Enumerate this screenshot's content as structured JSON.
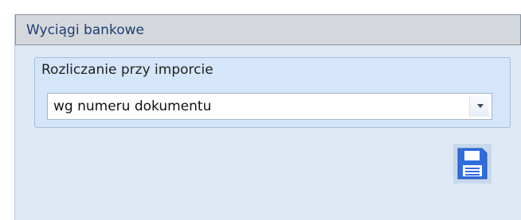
{
  "panel": {
    "title": "Wyciągi bankowe"
  },
  "group": {
    "label": "Rozliczanie przy imporcie",
    "select": {
      "value": "wg numeru dokumentu",
      "icon": "chevron-down-icon"
    }
  },
  "toolbar": {
    "save_icon": "floppy-disk-icon"
  },
  "colors": {
    "panel_background": "#dfe9f5",
    "header_background": "#d4d7dc",
    "title_text": "#1e3f72",
    "group_background": "#d5e5fa",
    "save_icon": "#2f6ddf"
  }
}
